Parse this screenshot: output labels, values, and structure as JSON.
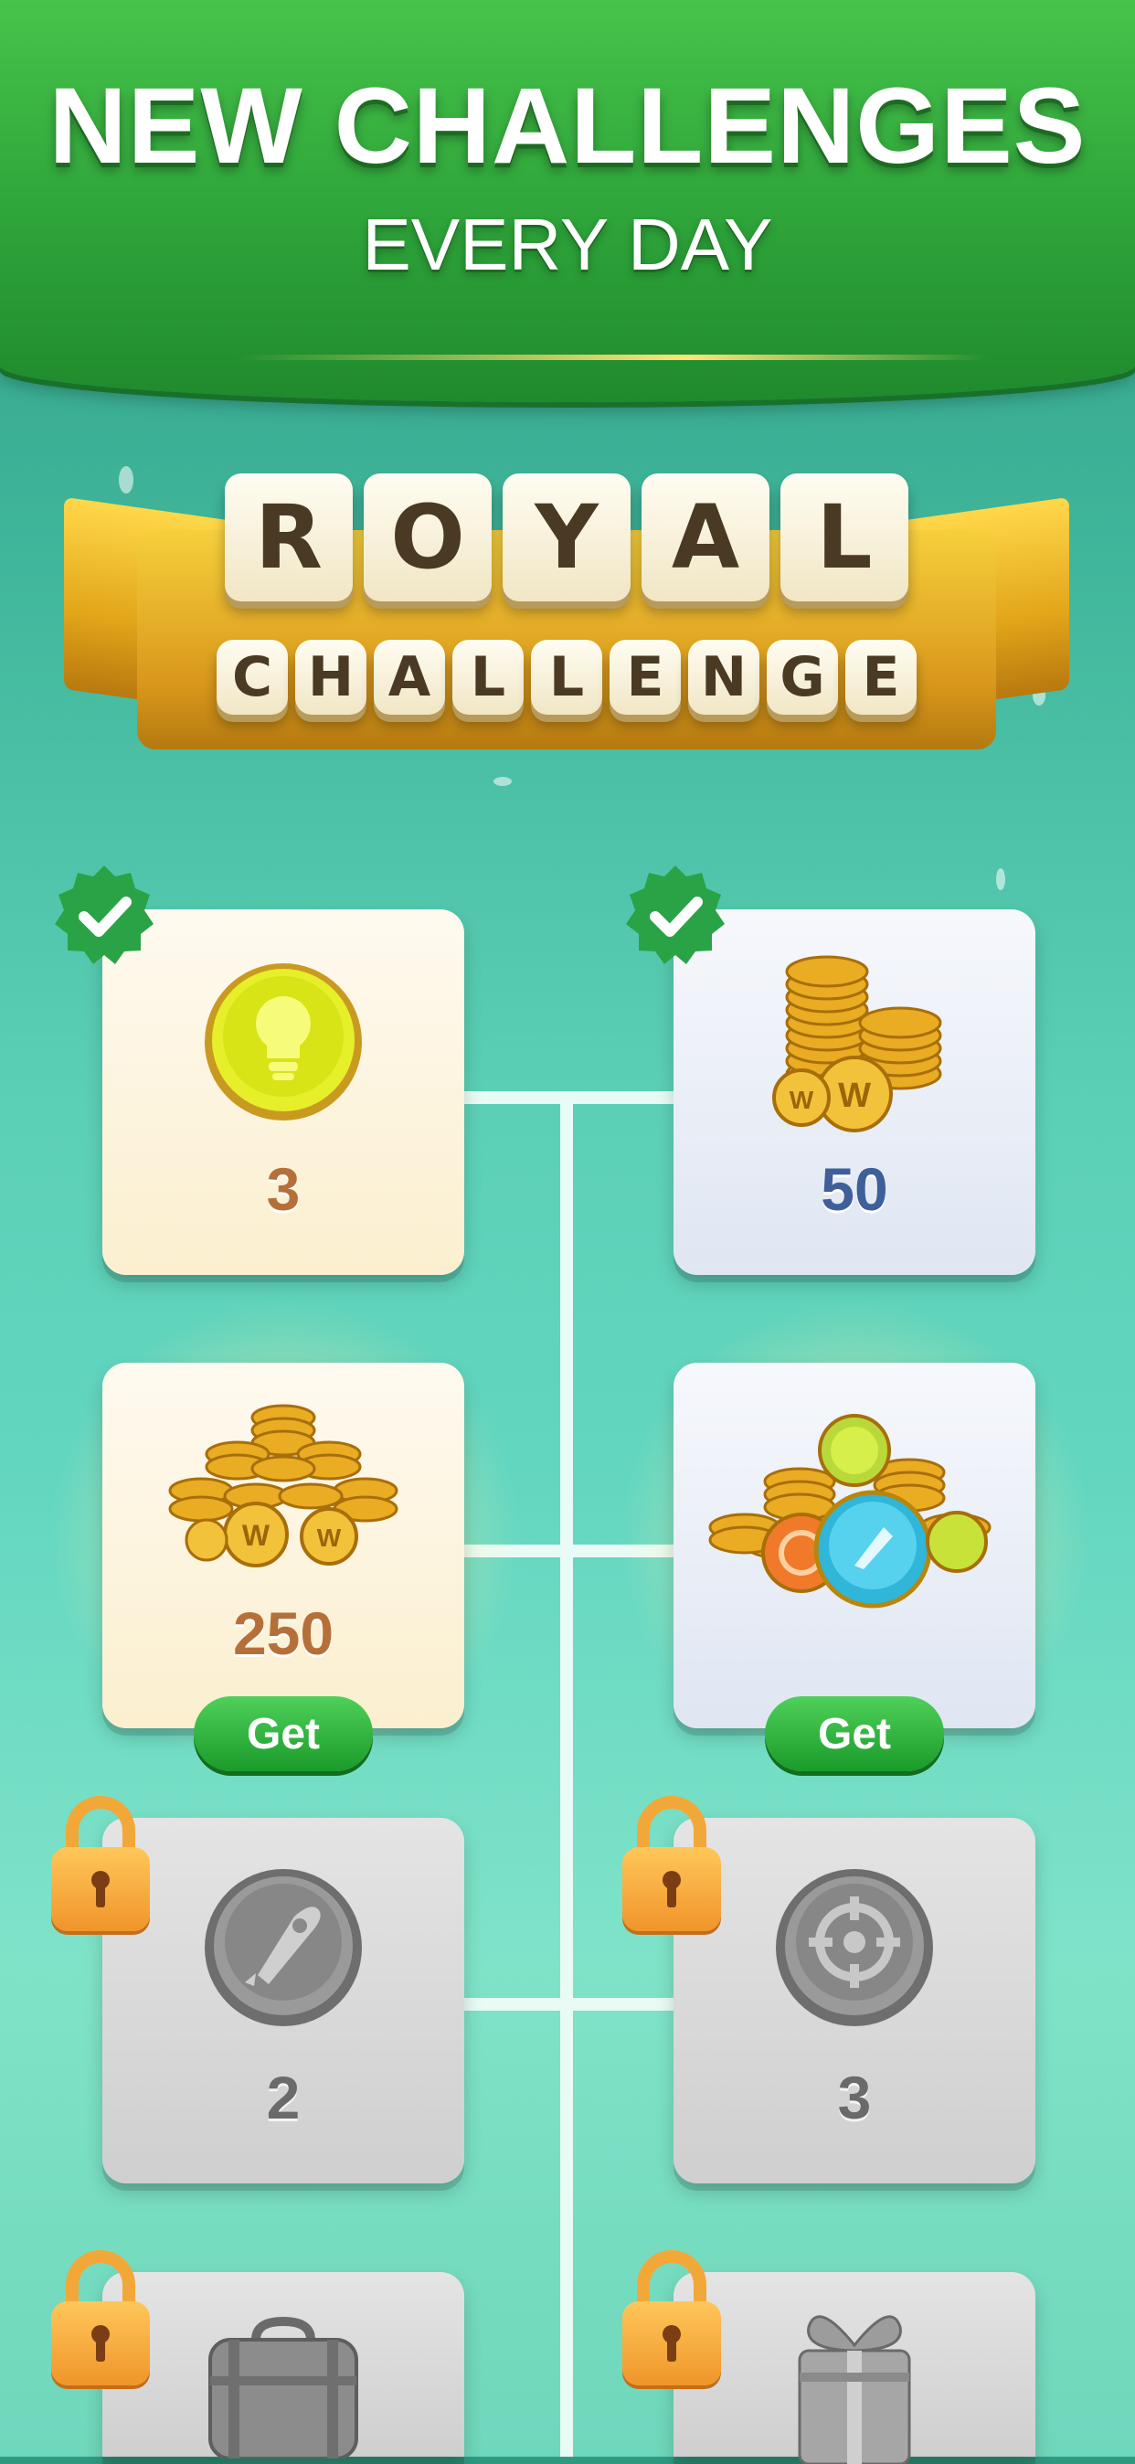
{
  "header": {
    "title": "NEW CHALLENGES",
    "subtitle": "EVERY DAY"
  },
  "logo": {
    "line1": [
      "R",
      "O",
      "Y",
      "A",
      "L"
    ],
    "line2": [
      "C",
      "H",
      "A",
      "L",
      "L",
      "E",
      "N",
      "G",
      "E"
    ]
  },
  "colors": {
    "header_green": "#2ea43a",
    "background_teal": "#5cd0b6",
    "get_button_green": "#1a9b2a",
    "value_brown": "#b5703a",
    "value_blue": "#3f5f9a",
    "lock_orange": "#f2a838"
  },
  "rewards": [
    {
      "id": "r1",
      "icon": "lightbulb-coin-icon",
      "value": "3",
      "status": "completed"
    },
    {
      "id": "r2",
      "icon": "coin-stack-icon",
      "value": "50",
      "status": "completed"
    },
    {
      "id": "r3",
      "icon": "coin-pile-icon",
      "value": "250",
      "status": "available",
      "button": "Get"
    },
    {
      "id": "r4",
      "icon": "coins-and-boosters-icon",
      "value": "",
      "status": "available",
      "button": "Get"
    },
    {
      "id": "r5",
      "icon": "rocket-coin-icon",
      "value": "2",
      "status": "locked"
    },
    {
      "id": "r6",
      "icon": "target-coin-icon",
      "value": "3",
      "status": "locked"
    },
    {
      "id": "r7",
      "icon": "suitcase-icon",
      "value": "",
      "status": "locked"
    },
    {
      "id": "r8",
      "icon": "gift-box-icon",
      "value": "",
      "status": "locked"
    }
  ]
}
